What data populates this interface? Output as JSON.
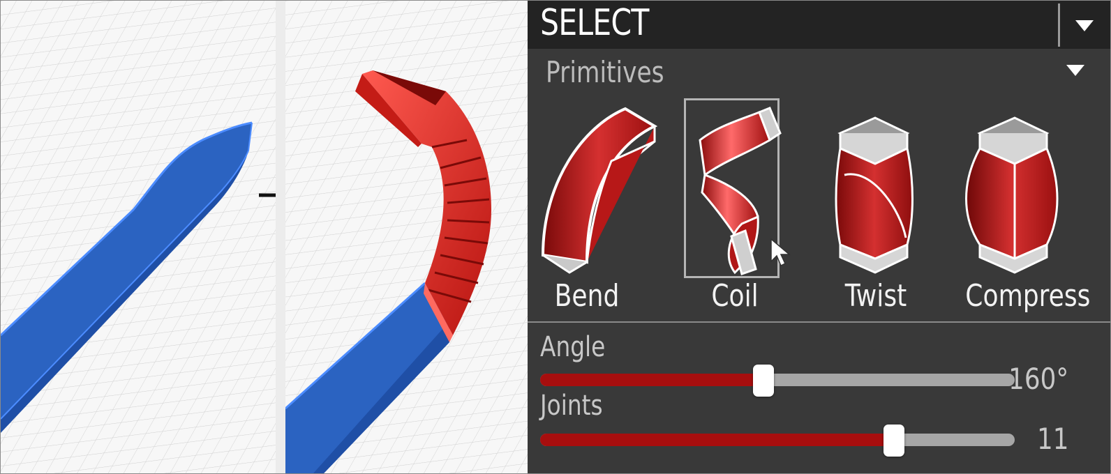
{
  "header": {
    "title": "SELECT"
  },
  "section": {
    "title": "Primitives"
  },
  "tools": [
    {
      "label": "Bend",
      "icon": "bend-icon",
      "selected": false
    },
    {
      "label": "Coil",
      "icon": "coil-icon",
      "selected": true
    },
    {
      "label": "Twist",
      "icon": "twist-icon",
      "selected": false
    },
    {
      "label": "Compress",
      "icon": "compress-icon",
      "selected": false
    }
  ],
  "sliders": {
    "angle": {
      "label": "Angle",
      "value": "160°",
      "fraction": 0.47
    },
    "joints": {
      "label": "Joints",
      "value": "11",
      "fraction": 0.745
    }
  },
  "colors": {
    "accent_red": "#a70e0e",
    "model_blue": "#2e66c4",
    "model_red": "#e0302c",
    "panel_bg": "#393939",
    "header_bg": "#232323"
  },
  "viewport": {
    "before_icon": "straight-beam-model",
    "arrow_icon": "right-arrow-icon",
    "after_icon": "bent-beam-model"
  }
}
